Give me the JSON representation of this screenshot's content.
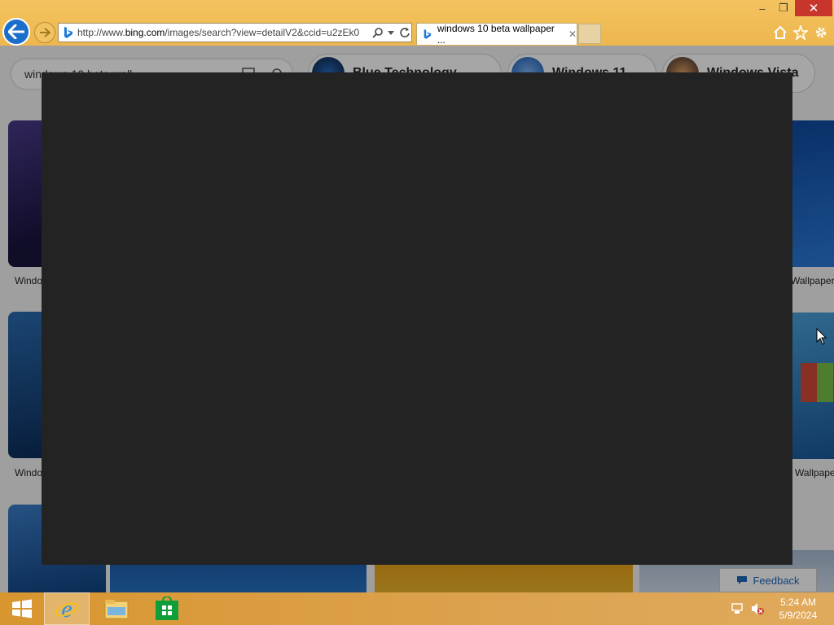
{
  "window": {
    "controls": {
      "minimize": "–",
      "maximize": "❐",
      "close": "✕"
    }
  },
  "nav": {
    "address_prefix": "http://www.",
    "address_host": "bing.com",
    "address_rest": "/images/search?view=detailV2&ccid=u2zEk0",
    "tab_title": "windows 10 beta wallpaper ...",
    "tab_close": "✕"
  },
  "page": {
    "search_text": "windows 10 beta wall",
    "pills": [
      {
        "label": "Blue Technology"
      },
      {
        "label": "Windows 11"
      },
      {
        "label": "Windows Vista"
      }
    ],
    "captions": {
      "left_1": "Windo",
      "left_2": "Windo",
      "right_1": "Wallpaper",
      "right_2": "a Wallpape"
    },
    "feedback": "Feedback"
  },
  "taskbar": {
    "time": "5:24 AM",
    "date": "5/9/2024"
  },
  "colors": {
    "accent": "#1b6ec9",
    "titlebar": "#f0bb55",
    "modal": "#232323",
    "close": "#c7352b"
  }
}
